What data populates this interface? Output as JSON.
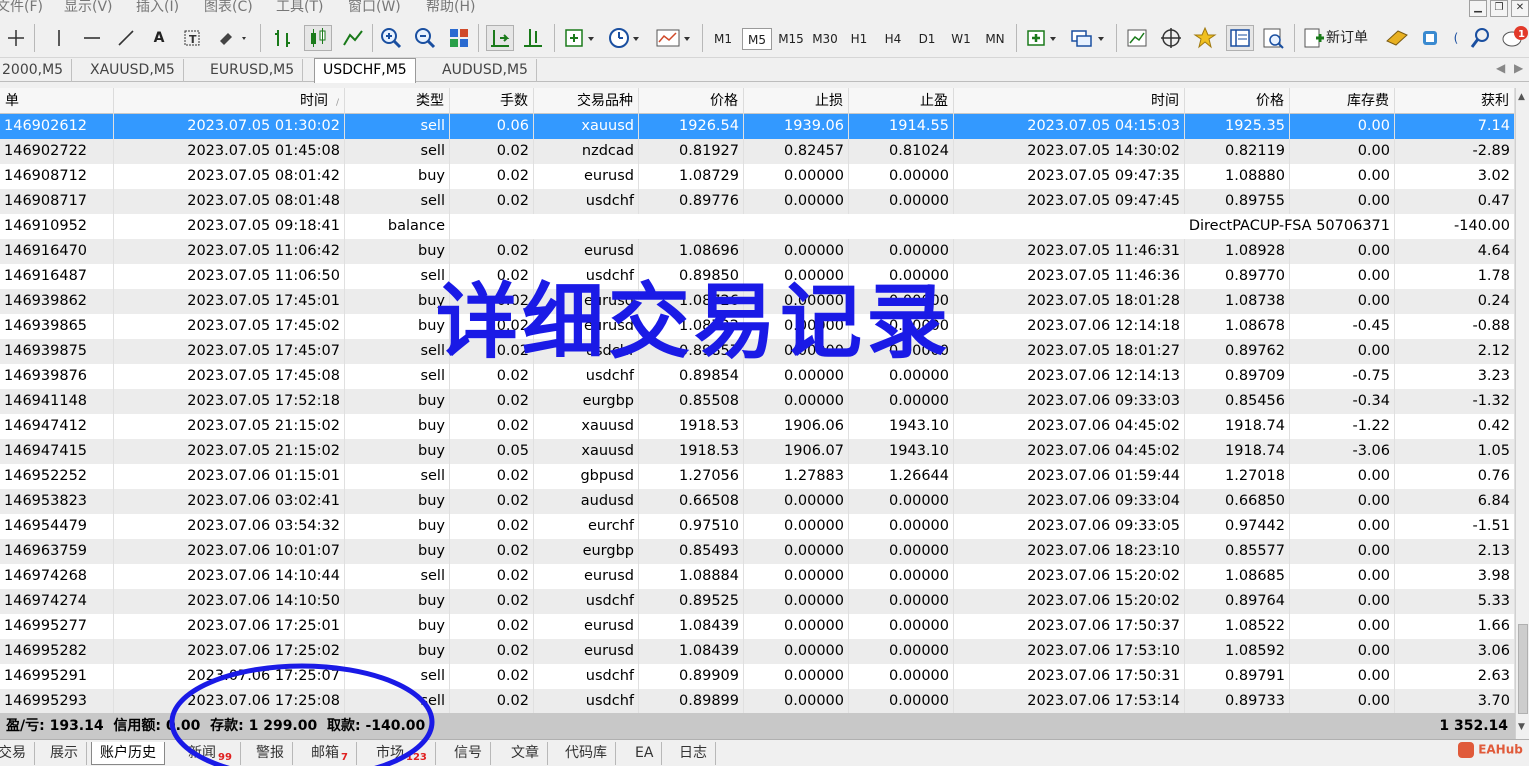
{
  "menu": [
    "文件(F)",
    "显示(V)",
    "插入(I)",
    "图表(C)",
    "工具(T)",
    "窗口(W)",
    "帮助(H)"
  ],
  "timeframes": [
    "M1",
    "M5",
    "M15",
    "M30",
    "H1",
    "H4",
    "D1",
    "W1",
    "MN"
  ],
  "active_timeframe": "M5",
  "toolbar": {
    "new_order_label": "新订单"
  },
  "chart_tabs": [
    "2000,M5",
    "XAUUSD,M5",
    "EURUSD,M5",
    "USDCHF,M5",
    "AUDUSD,M5"
  ],
  "active_chart_tab": "USDCHF,M5",
  "columns": {
    "order": "单",
    "open_time": "时间",
    "type": "类型",
    "lots": "手数",
    "symbol": "交易品种",
    "open_price": "价格",
    "sl": "止损",
    "tp": "止盈",
    "close_time": "时间",
    "close_price": "价格",
    "swap": "库存费",
    "profit": "获利"
  },
  "rows": [
    {
      "order": "146902612",
      "open_time": "2023.07.05 01:30:02",
      "type": "sell",
      "lots": "0.06",
      "symbol": "xauusd",
      "open_price": "1926.54",
      "sl": "1939.06",
      "tp": "1914.55",
      "close_time": "2023.07.05 04:15:03",
      "close_price": "1925.35",
      "swap": "0.00",
      "profit": "7.14"
    },
    {
      "order": "146902722",
      "open_time": "2023.07.05 01:45:08",
      "type": "sell",
      "lots": "0.02",
      "symbol": "nzdcad",
      "open_price": "0.81927",
      "sl": "0.82457",
      "tp": "0.81024",
      "close_time": "2023.07.05 14:30:02",
      "close_price": "0.82119",
      "swap": "0.00",
      "profit": "-2.89"
    },
    {
      "order": "146908712",
      "open_time": "2023.07.05 08:01:42",
      "type": "buy",
      "lots": "0.02",
      "symbol": "eurusd",
      "open_price": "1.08729",
      "sl": "0.00000",
      "tp": "0.00000",
      "close_time": "2023.07.05 09:47:35",
      "close_price": "1.08880",
      "swap": "0.00",
      "profit": "3.02"
    },
    {
      "order": "146908717",
      "open_time": "2023.07.05 08:01:48",
      "type": "sell",
      "lots": "0.02",
      "symbol": "usdchf",
      "open_price": "0.89776",
      "sl": "0.00000",
      "tp": "0.00000",
      "close_time": "2023.07.05 09:47:45",
      "close_price": "0.89755",
      "swap": "0.00",
      "profit": "0.47"
    },
    {
      "order": "146910952",
      "open_time": "2023.07.05 09:18:41",
      "type": "balance",
      "lots": "",
      "symbol": "",
      "open_price": "",
      "sl": "",
      "tp": "",
      "close_time": "",
      "close_price": "",
      "swap": "",
      "profit": "-140.00",
      "comment": "DirectPACUP-FSA 50706371"
    },
    {
      "order": "146916470",
      "open_time": "2023.07.05 11:06:42",
      "type": "buy",
      "lots": "0.02",
      "symbol": "eurusd",
      "open_price": "1.08696",
      "sl": "0.00000",
      "tp": "0.00000",
      "close_time": "2023.07.05 11:46:31",
      "close_price": "1.08928",
      "swap": "0.00",
      "profit": "4.64"
    },
    {
      "order": "146916487",
      "open_time": "2023.07.05 11:06:50",
      "type": "sell",
      "lots": "0.02",
      "symbol": "usdchf",
      "open_price": "0.89850",
      "sl": "0.00000",
      "tp": "0.00000",
      "close_time": "2023.07.05 11:46:36",
      "close_price": "0.89770",
      "swap": "0.00",
      "profit": "1.78"
    },
    {
      "order": "146939862",
      "open_time": "2023.07.05 17:45:01",
      "type": "buy",
      "lots": "0.02",
      "symbol": "eurusd",
      "open_price": "1.08726",
      "sl": "0.00000",
      "tp": "0.00000",
      "close_time": "2023.07.05 18:01:28",
      "close_price": "1.08738",
      "swap": "0.00",
      "profit": "0.24"
    },
    {
      "order": "146939865",
      "open_time": "2023.07.05 17:45:02",
      "type": "buy",
      "lots": "0.02",
      "symbol": "eurusd",
      "open_price": "1.08722",
      "sl": "0.00000",
      "tp": "0.00000",
      "close_time": "2023.07.06 12:14:18",
      "close_price": "1.08678",
      "swap": "-0.45",
      "profit": "-0.88"
    },
    {
      "order": "146939875",
      "open_time": "2023.07.05 17:45:07",
      "type": "sell",
      "lots": "0.02",
      "symbol": "usdchf",
      "open_price": "0.89857",
      "sl": "0.00000",
      "tp": "0.00000",
      "close_time": "2023.07.05 18:01:27",
      "close_price": "0.89762",
      "swap": "0.00",
      "profit": "2.12"
    },
    {
      "order": "146939876",
      "open_time": "2023.07.05 17:45:08",
      "type": "sell",
      "lots": "0.02",
      "symbol": "usdchf",
      "open_price": "0.89854",
      "sl": "0.00000",
      "tp": "0.00000",
      "close_time": "2023.07.06 12:14:13",
      "close_price": "0.89709",
      "swap": "-0.75",
      "profit": "3.23"
    },
    {
      "order": "146941148",
      "open_time": "2023.07.05 17:52:18",
      "type": "buy",
      "lots": "0.02",
      "symbol": "eurgbp",
      "open_price": "0.85508",
      "sl": "0.00000",
      "tp": "0.00000",
      "close_time": "2023.07.06 09:33:03",
      "close_price": "0.85456",
      "swap": "-0.34",
      "profit": "-1.32"
    },
    {
      "order": "146947412",
      "open_time": "2023.07.05 21:15:02",
      "type": "buy",
      "lots": "0.02",
      "symbol": "xauusd",
      "open_price": "1918.53",
      "sl": "1906.06",
      "tp": "1943.10",
      "close_time": "2023.07.06 04:45:02",
      "close_price": "1918.74",
      "swap": "-1.22",
      "profit": "0.42"
    },
    {
      "order": "146947415",
      "open_time": "2023.07.05 21:15:02",
      "type": "buy",
      "lots": "0.05",
      "symbol": "xauusd",
      "open_price": "1918.53",
      "sl": "1906.07",
      "tp": "1943.10",
      "close_time": "2023.07.06 04:45:02",
      "close_price": "1918.74",
      "swap": "-3.06",
      "profit": "1.05"
    },
    {
      "order": "146952252",
      "open_time": "2023.07.06 01:15:01",
      "type": "sell",
      "lots": "0.02",
      "symbol": "gbpusd",
      "open_price": "1.27056",
      "sl": "1.27883",
      "tp": "1.26644",
      "close_time": "2023.07.06 01:59:44",
      "close_price": "1.27018",
      "swap": "0.00",
      "profit": "0.76"
    },
    {
      "order": "146953823",
      "open_time": "2023.07.06 03:02:41",
      "type": "buy",
      "lots": "0.02",
      "symbol": "audusd",
      "open_price": "0.66508",
      "sl": "0.00000",
      "tp": "0.00000",
      "close_time": "2023.07.06 09:33:04",
      "close_price": "0.66850",
      "swap": "0.00",
      "profit": "6.84"
    },
    {
      "order": "146954479",
      "open_time": "2023.07.06 03:54:32",
      "type": "buy",
      "lots": "0.02",
      "symbol": "eurchf",
      "open_price": "0.97510",
      "sl": "0.00000",
      "tp": "0.00000",
      "close_time": "2023.07.06 09:33:05",
      "close_price": "0.97442",
      "swap": "0.00",
      "profit": "-1.51"
    },
    {
      "order": "146963759",
      "open_time": "2023.07.06 10:01:07",
      "type": "buy",
      "lots": "0.02",
      "symbol": "eurgbp",
      "open_price": "0.85493",
      "sl": "0.00000",
      "tp": "0.00000",
      "close_time": "2023.07.06 18:23:10",
      "close_price": "0.85577",
      "swap": "0.00",
      "profit": "2.13"
    },
    {
      "order": "146974268",
      "open_time": "2023.07.06 14:10:44",
      "type": "sell",
      "lots": "0.02",
      "symbol": "eurusd",
      "open_price": "1.08884",
      "sl": "0.00000",
      "tp": "0.00000",
      "close_time": "2023.07.06 15:20:02",
      "close_price": "1.08685",
      "swap": "0.00",
      "profit": "3.98"
    },
    {
      "order": "146974274",
      "open_time": "2023.07.06 14:10:50",
      "type": "buy",
      "lots": "0.02",
      "symbol": "usdchf",
      "open_price": "0.89525",
      "sl": "0.00000",
      "tp": "0.00000",
      "close_time": "2023.07.06 15:20:02",
      "close_price": "0.89764",
      "swap": "0.00",
      "profit": "5.33"
    },
    {
      "order": "146995277",
      "open_time": "2023.07.06 17:25:01",
      "type": "buy",
      "lots": "0.02",
      "symbol": "eurusd",
      "open_price": "1.08439",
      "sl": "0.00000",
      "tp": "0.00000",
      "close_time": "2023.07.06 17:50:37",
      "close_price": "1.08522",
      "swap": "0.00",
      "profit": "1.66"
    },
    {
      "order": "146995282",
      "open_time": "2023.07.06 17:25:02",
      "type": "buy",
      "lots": "0.02",
      "symbol": "eurusd",
      "open_price": "1.08439",
      "sl": "0.00000",
      "tp": "0.00000",
      "close_time": "2023.07.06 17:53:10",
      "close_price": "1.08592",
      "swap": "0.00",
      "profit": "3.06"
    },
    {
      "order": "146995291",
      "open_time": "2023.07.06 17:25:07",
      "type": "sell",
      "lots": "0.02",
      "symbol": "usdchf",
      "open_price": "0.89909",
      "sl": "0.00000",
      "tp": "0.00000",
      "close_time": "2023.07.06 17:50:31",
      "close_price": "0.89791",
      "swap": "0.00",
      "profit": "2.63"
    },
    {
      "order": "146995293",
      "open_time": "2023.07.06 17:25:08",
      "type": "sell",
      "lots": "0.02",
      "symbol": "usdchf",
      "open_price": "0.89899",
      "sl": "0.00000",
      "tp": "0.00000",
      "close_time": "2023.07.06 17:53:14",
      "close_price": "0.89733",
      "swap": "0.00",
      "profit": "3.70"
    }
  ],
  "summary": {
    "text": "盈/亏: 193.14  信用额: 0.00  存款: 1 299.00  取款: -140.00",
    "total": "1 352.14"
  },
  "bottom_tabs": [
    {
      "label": "交易",
      "badge": ""
    },
    {
      "label": "展示",
      "badge": ""
    },
    {
      "label": "账户历史",
      "badge": ""
    },
    {
      "label": "新闻",
      "badge": "99"
    },
    {
      "label": "警报",
      "badge": ""
    },
    {
      "label": "邮箱",
      "badge": "7"
    },
    {
      "label": "市场",
      "badge": "123"
    },
    {
      "label": "信号",
      "badge": ""
    },
    {
      "label": "文章",
      "badge": ""
    },
    {
      "label": "代码库",
      "badge": ""
    },
    {
      "label": "EA",
      "badge": ""
    },
    {
      "label": "日志",
      "badge": ""
    }
  ],
  "active_bottom_tab": "账户历史",
  "notification_badge": "1",
  "overlay_text": "详细交易记录",
  "watermark": "EAHub",
  "colors": {
    "selection": "#3399ff",
    "overlay": "#1a1ae6",
    "badge": "#e02020"
  }
}
